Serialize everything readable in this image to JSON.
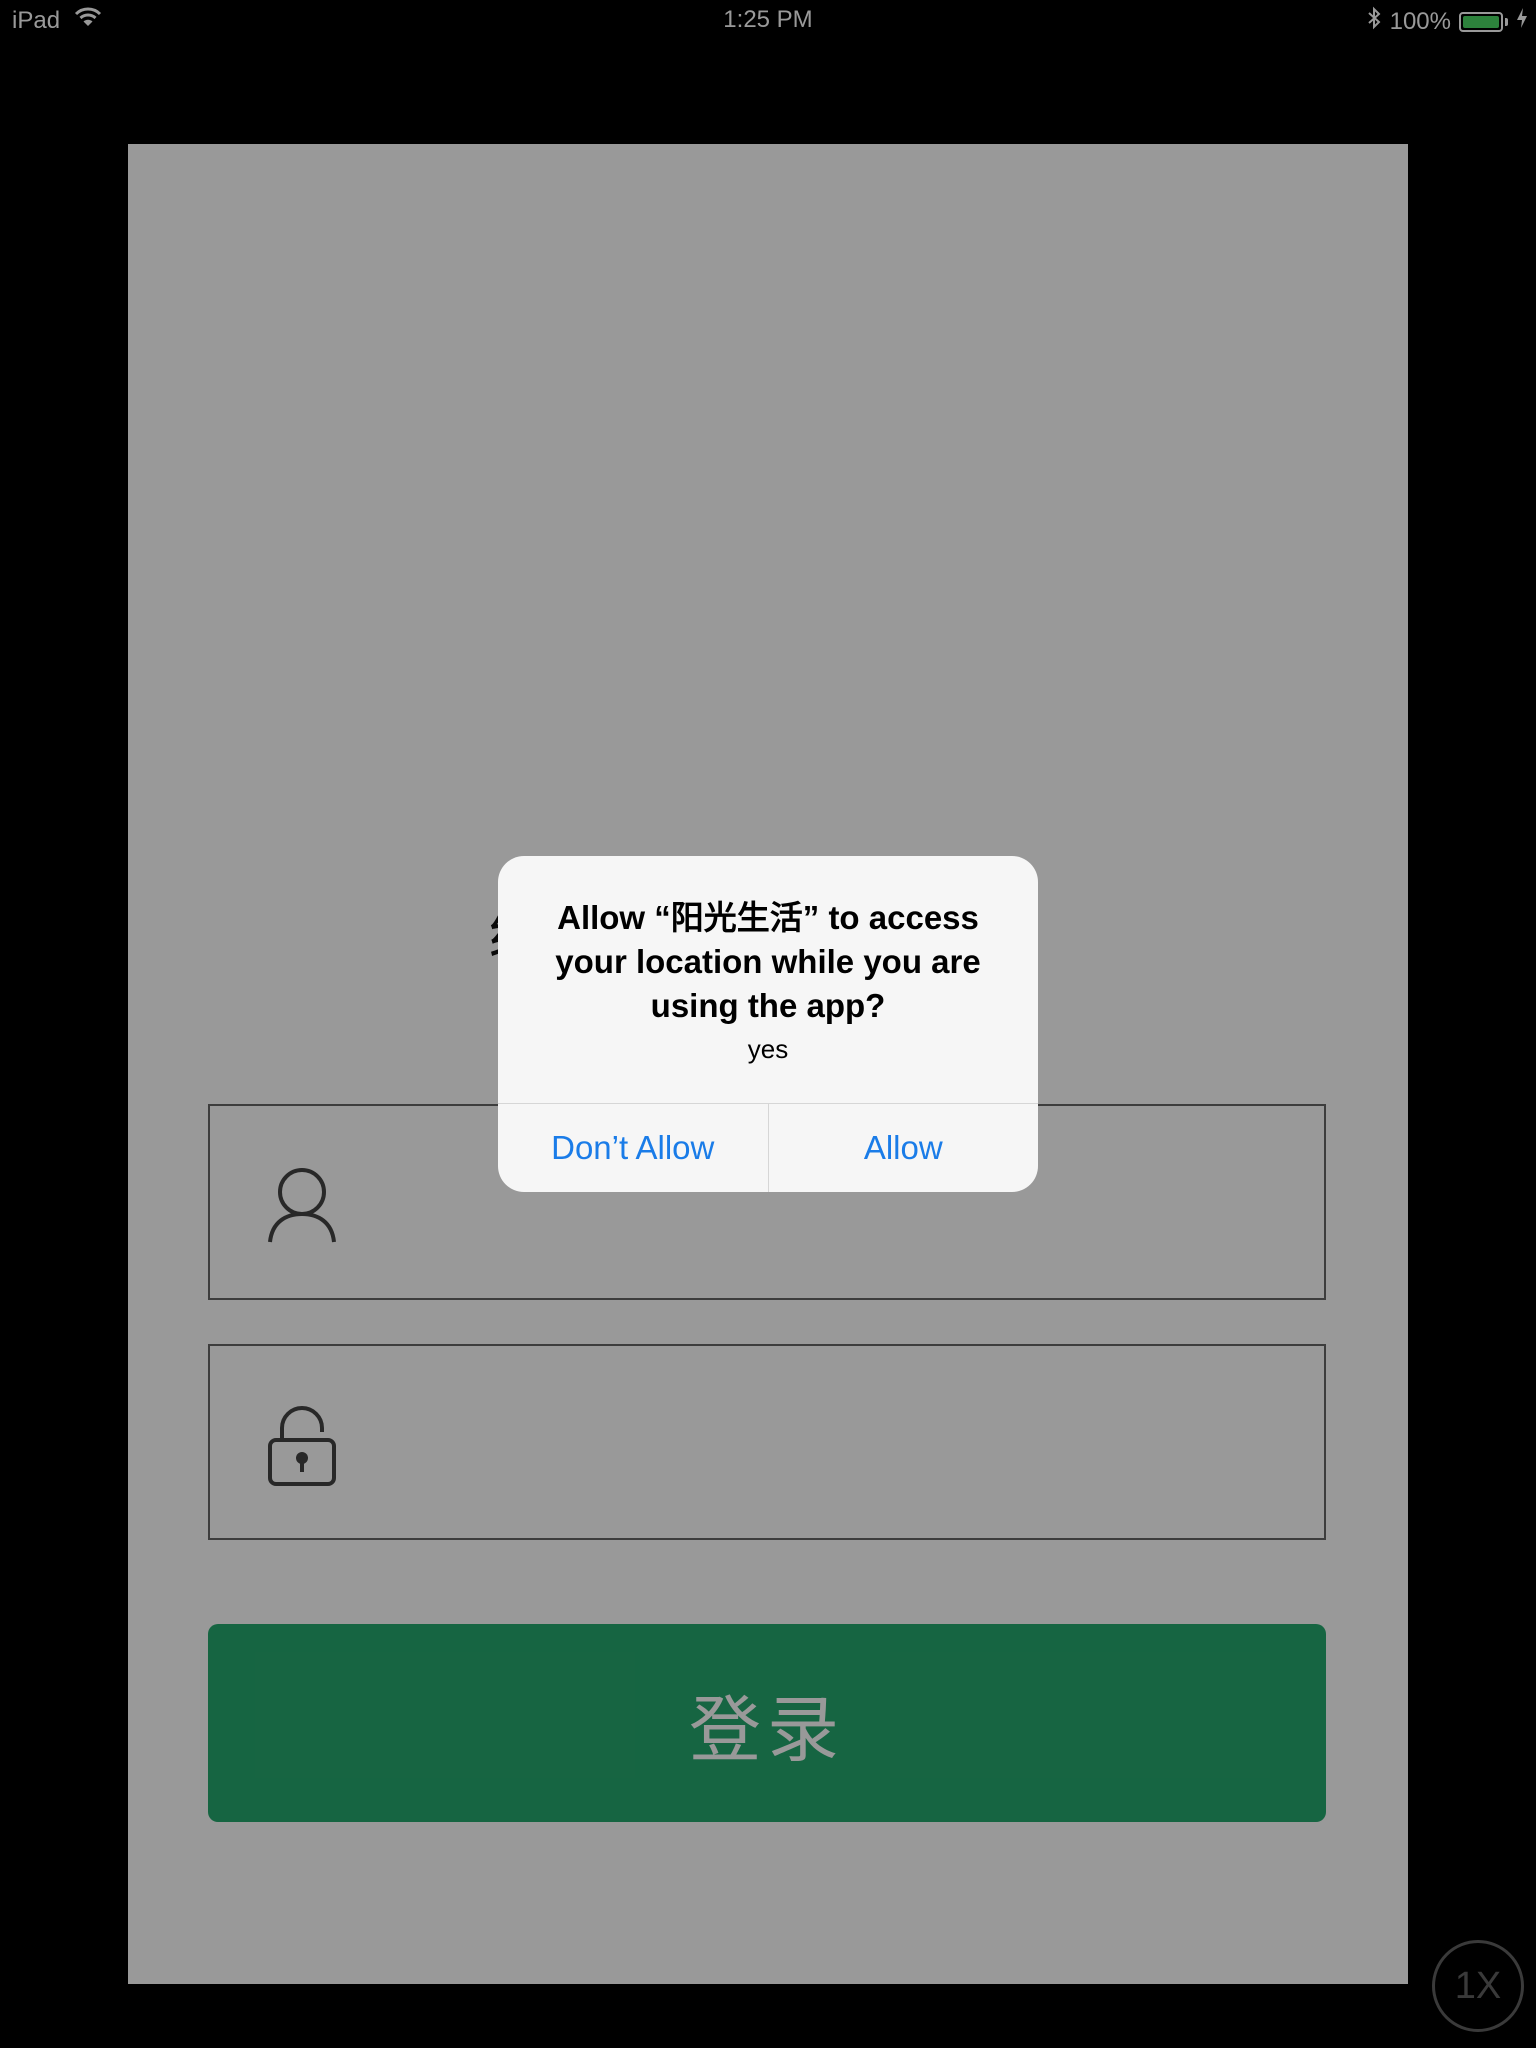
{
  "status_bar": {
    "device": "iPad",
    "time": "1:25 PM",
    "battery": "100%",
    "icons": [
      "wifi-icon",
      "bluetooth-icon",
      "battery-icon",
      "charging-icon"
    ],
    "battery_color": "#4cd964"
  },
  "app": {
    "title": "绵阳市 务平台",
    "username_icon": "user-icon",
    "password_icon": "unlocked-padlock-icon",
    "login_button": "登录",
    "login_button_color": "#26a96e"
  },
  "alert": {
    "title": "Allow “阳光生活” to access your location while you are using the app?",
    "message": "yes",
    "buttons": {
      "deny": "Don’t Allow",
      "allow": "Allow"
    },
    "button_color": "#1a7ce8"
  },
  "zoom_badge": "1X"
}
